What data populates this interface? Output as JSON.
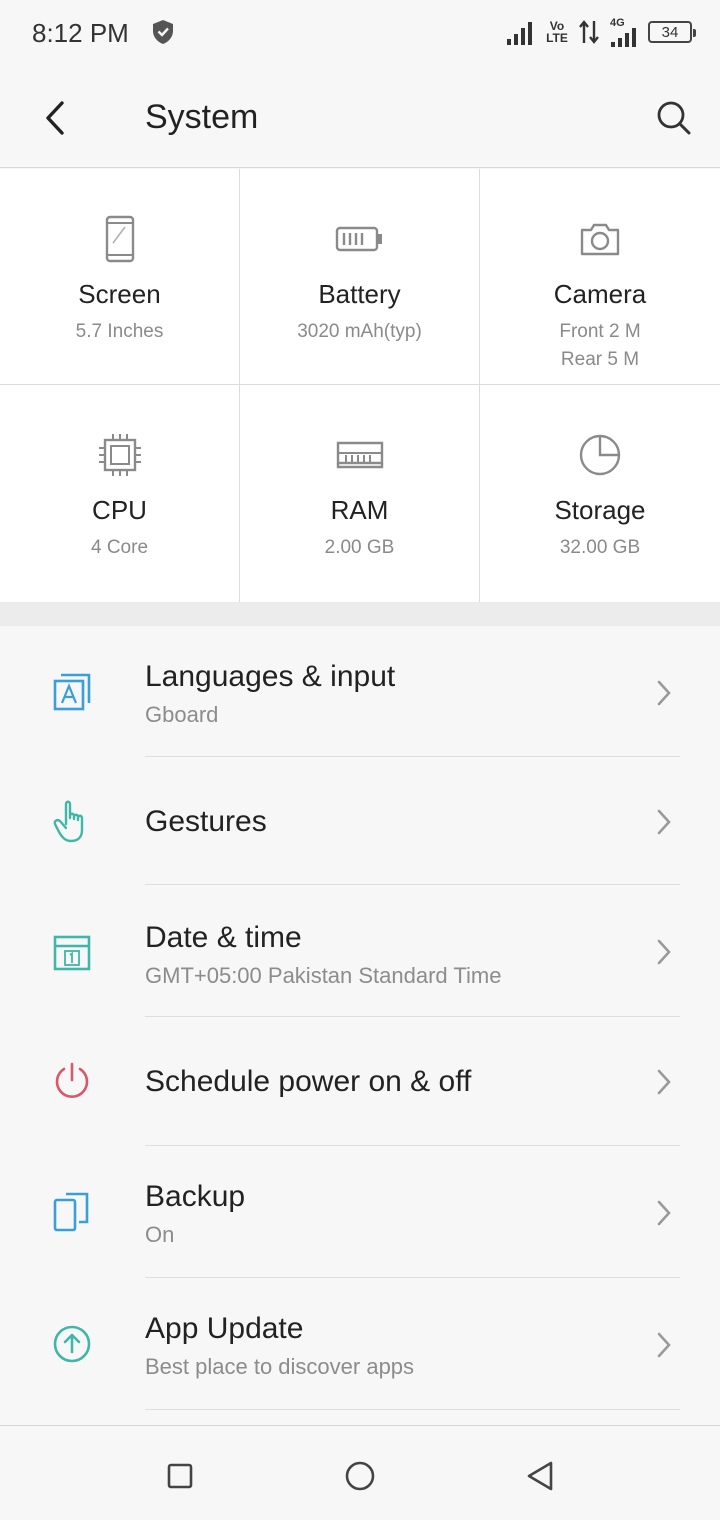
{
  "status_bar": {
    "time": "8:12 PM",
    "icons": [
      "shield-icon",
      "signal-icon",
      "volte-icon",
      "data-arrows-icon",
      "4g-signal-icon",
      "battery-icon"
    ],
    "volte_line1": "Vo",
    "volte_line2": "LTE",
    "network_type": "4G",
    "battery_level": "34"
  },
  "app_bar": {
    "title": "System",
    "back_icon": "chevron-left-icon",
    "search_icon": "search-icon"
  },
  "specs": [
    {
      "icon": "phone-screen-icon",
      "label": "Screen",
      "value": "5.7 Inches"
    },
    {
      "icon": "battery-icon",
      "label": "Battery",
      "value": "3020 mAh(typ)"
    },
    {
      "icon": "camera-icon",
      "label": "Camera",
      "value": "Front 2 M",
      "value2": "Rear 5 M"
    },
    {
      "icon": "cpu-icon",
      "label": "CPU",
      "value": "4 Core"
    },
    {
      "icon": "ram-icon",
      "label": "RAM",
      "value": "2.00 GB"
    },
    {
      "icon": "pie-chart-icon",
      "label": "Storage",
      "value": "32.00 GB"
    }
  ],
  "settings": [
    {
      "icon": "language-icon",
      "title": "Languages & input",
      "subtitle": "Gboard"
    },
    {
      "icon": "gesture-hand-icon",
      "title": "Gestures",
      "subtitle": ""
    },
    {
      "icon": "calendar-icon",
      "title": "Date & time",
      "subtitle": "GMT+05:00 Pakistan Standard Time"
    },
    {
      "icon": "power-icon",
      "title": "Schedule power on & off",
      "subtitle": ""
    },
    {
      "icon": "backup-icon",
      "title": "Backup",
      "subtitle": "On"
    },
    {
      "icon": "upload-arrow-icon",
      "title": "App Update",
      "subtitle": "Best place to discover apps"
    }
  ],
  "nav_bar": {
    "recents_icon": "square-icon",
    "home_icon": "circle-icon",
    "back_icon": "triangle-back-icon"
  },
  "colors": {
    "background": "#f7f7f7",
    "card": "#ffffff",
    "teal": "#3fb6a8",
    "blue": "#3a9fd8",
    "red": "#d9576a",
    "icon_gray": "#8a8a8a"
  }
}
